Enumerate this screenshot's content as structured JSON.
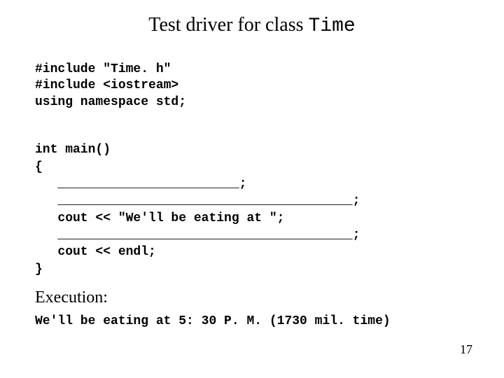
{
  "title_prefix": "Test driver for class ",
  "title_class": "Time",
  "code": {
    "includes": "#include \"Time. h\"\n#include <iostream>\nusing namespace std;",
    "main_open": "int main()\n{",
    "blank1": "   ________________________;",
    "blank2": "   _______________________________________;",
    "cout1": "   cout << \"We'll be eating at \";",
    "blank3": "   _______________________________________;",
    "cout2": "   cout << endl;",
    "main_close": "}"
  },
  "execution_label": "Execution:",
  "output_text": "We'll be eating at 5: 30 P. M.  (1730 mil. time)",
  "page_number": "17"
}
